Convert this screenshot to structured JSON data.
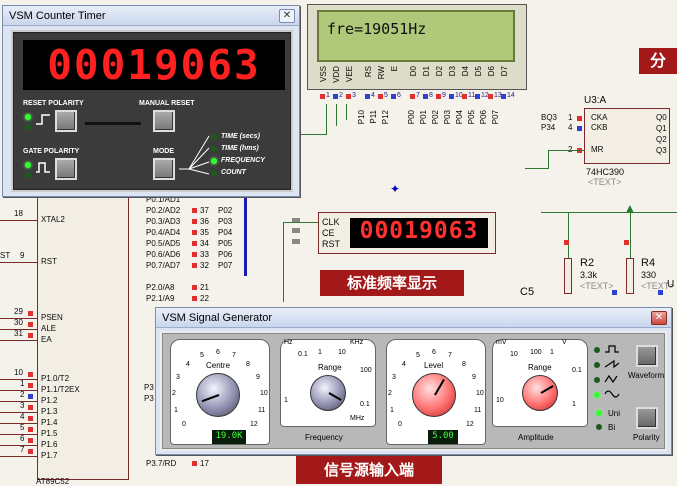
{
  "counter_timer": {
    "title": "VSM Counter Timer",
    "close": "✕",
    "display_digits": "00019063",
    "labels": {
      "reset_polarity": "RESET POLARITY",
      "manual_reset": "MANUAL RESET",
      "gate_polarity": "GATE POLARITY",
      "mode": "MODE"
    },
    "modes": [
      "TIME (secs)",
      "TIME (hms)",
      "FREQUENCY",
      "COUNT"
    ],
    "active_mode_index": 2
  },
  "lcd": {
    "text": "fre=19051Hz",
    "pins": [
      "VSS",
      "VDD",
      "VEE",
      "RS",
      "RW",
      "E",
      "D0",
      "D1",
      "D2",
      "D3",
      "D4",
      "D5",
      "D6",
      "D7"
    ],
    "pin_numbers": [
      "1",
      "2",
      "3",
      "4",
      "5",
      "6",
      "7",
      "8",
      "9",
      "10",
      "11",
      "12",
      "13",
      "14"
    ]
  },
  "lcd_wires": [
    "P10",
    "P11",
    "P12",
    "P00",
    "P01",
    "P02",
    "P03",
    "P04",
    "P05",
    "P06",
    "P07"
  ],
  "ic_74hc390": {
    "ref": "U3:A",
    "part": "74HC390",
    "text": "<TEXT>",
    "inputs": [
      {
        "net": "BQ3",
        "pin": "1",
        "name": "CKA"
      },
      {
        "net": "P34",
        "pin": "4",
        "name": "CKB"
      },
      {
        "net": "",
        "pin": "2",
        "name": "MR"
      }
    ],
    "outputs": [
      "Q0",
      "Q1",
      "Q2",
      "Q3"
    ]
  },
  "mcu": {
    "part": "AT89C52",
    "left_pins": [
      {
        "num": "18",
        "name": "XTAL2"
      },
      {
        "num": "9",
        "name": "RST",
        "net": "ST"
      },
      {
        "num": "29",
        "name": "PSEN"
      },
      {
        "num": "30",
        "name": "ALE"
      },
      {
        "num": "31",
        "name": "EA"
      },
      {
        "num": "10",
        "name": "P1.0/T2"
      },
      {
        "num": "1",
        "name": "P1.1/T2EX"
      },
      {
        "num": "2",
        "name": "P1.2"
      },
      {
        "num": "3",
        "name": "P1.3"
      },
      {
        "num": "4",
        "name": "P1.4"
      },
      {
        "num": "5",
        "name": "P1.5"
      },
      {
        "num": "6",
        "name": "P1.6"
      },
      {
        "num": "7",
        "name": "P1.7"
      }
    ],
    "right_pins": [
      {
        "name": "P0.1/AD1",
        "num": "",
        "net": ""
      },
      {
        "name": "P0.2/AD2",
        "num": "37",
        "net": "P02"
      },
      {
        "name": "P0.3/AD3",
        "num": "36",
        "net": "P03"
      },
      {
        "name": "P0.4/AD4",
        "num": "35",
        "net": "P04"
      },
      {
        "name": "P0.5/AD5",
        "num": "34",
        "net": "P05"
      },
      {
        "name": "P0.6/AD6",
        "num": "33",
        "net": "P06"
      },
      {
        "name": "P0.7/AD7",
        "num": "32",
        "net": "P07"
      },
      {
        "name": "P2.0/A8",
        "num": "21",
        "net": ""
      },
      {
        "name": "P2.1/A9",
        "num": "22",
        "net": ""
      },
      {
        "name": "P3.7/RD",
        "num": "17",
        "net": ""
      }
    ],
    "misc_right": [
      "P3",
      "P3"
    ]
  },
  "counter_block": {
    "pins": [
      "CLK",
      "CE",
      "RST"
    ],
    "display": "00019063"
  },
  "cn_label_display": "标准频率显示",
  "cn_label_input": "信号源输入端",
  "cn_label_top_right": "分",
  "resistors": [
    {
      "ref": "R2",
      "value": "3.3k",
      "text": "<TEXT>"
    },
    {
      "ref": "R4",
      "value": "330",
      "text": "<TEXT>"
    }
  ],
  "capacitor": {
    "ref": "C5"
  },
  "u_fragment": "U",
  "signal_gen": {
    "title": "VSM Signal Generator",
    "close": "✕",
    "freq_group": "Frequency",
    "amp_group": "Amplitude",
    "centre": {
      "label": "Centre",
      "scale": [
        "0",
        "1",
        "2",
        "3",
        "4",
        "5",
        "6",
        "7",
        "8",
        "9",
        "10",
        "11",
        "12"
      ],
      "display": "19.0K"
    },
    "range_f": {
      "label": "Range",
      "scale": [
        "0.1",
        "1",
        "10",
        "100",
        "0.1",
        "1"
      ],
      "units_left": "Hz",
      "units_right": "KHz",
      "units_bottom": "MHz"
    },
    "level": {
      "label": "Level",
      "scale": [
        "0",
        "1",
        "2",
        "3",
        "4",
        "5",
        "6",
        "7",
        "8",
        "9",
        "10",
        "11",
        "12"
      ],
      "display": "5.00"
    },
    "range_a": {
      "label": "Range",
      "scale": [
        "10",
        "100",
        "1",
        "0.1",
        "1",
        "10"
      ],
      "units_left": "mV",
      "units_right": "V"
    },
    "waveform_label": "Waveform",
    "polarity_label": "Polarity",
    "uni": "Uni",
    "bi": "Bi",
    "waveforms": [
      "square",
      "sawtooth",
      "triangle",
      "sine"
    ],
    "active_waveform_index": 3
  },
  "colors": {
    "wire": "#2e7a2e",
    "bus": "#1a1ab0",
    "seg_red": "#ff2020",
    "lcd_bg": "#b0c87a",
    "window_bg": "#dde4f2"
  }
}
